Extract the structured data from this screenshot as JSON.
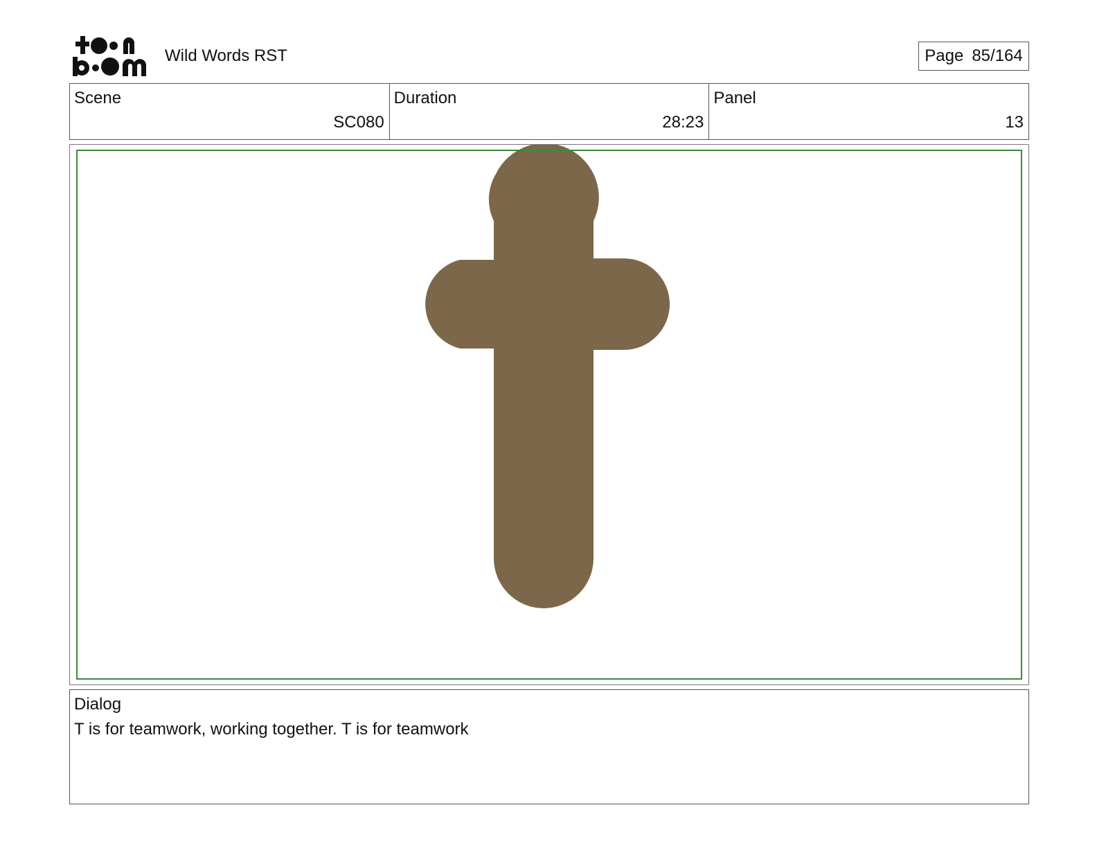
{
  "header": {
    "logo_text": "toon boom",
    "project_title": "Wild Words RST",
    "page_label": "Page",
    "page_number": "85/164"
  },
  "info": {
    "scene_label": "Scene",
    "scene_value": "SC080",
    "duration_label": "Duration",
    "duration_value": "28:23",
    "panel_label": "Panel",
    "panel_value": "13"
  },
  "panel": {
    "artwork": "letter-t-shape",
    "art_color": "#7d674a",
    "safe_frame_color": "#3a8a3a"
  },
  "dialog": {
    "label": "Dialog",
    "text": "T is for teamwork, working together. T is for teamwork"
  }
}
